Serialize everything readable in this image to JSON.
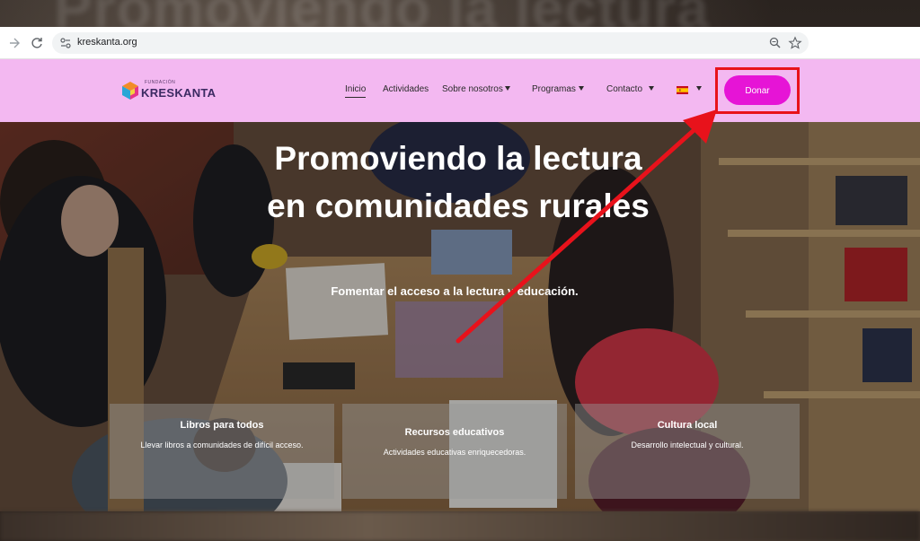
{
  "backdrop": {
    "blurred_title": "Promoviendo la lectura"
  },
  "browser": {
    "url": "kreskanta.org",
    "icons": {
      "back": "back-arrow-icon",
      "reload": "reload-icon",
      "site_info": "site-settings-icon",
      "zoom": "zoom-icon",
      "bookmark": "star-icon"
    }
  },
  "header": {
    "logo_small": "FUNDACIÓN",
    "logo_name": "KRESKANTA",
    "menu": {
      "inicio": "Inicio",
      "actividades": "Actividades",
      "sobre": "Sobre nosotros",
      "programas": "Programas",
      "contacto": "Contacto"
    },
    "language_flag": "spain-flag-icon",
    "donate_label": "Donar",
    "colors": {
      "header_bg": "#f3b8f1",
      "donate_bg": "#e614d6",
      "annotation": "#e8121b"
    }
  },
  "hero": {
    "title_line1": "Promoviendo la lectura",
    "title_line2": "en comunidades rurales",
    "subtitle": "Fomentar el acceso a la lectura y educación."
  },
  "features": [
    {
      "title": "Libros para todos",
      "desc": "Llevar libros a comunidades de difícil acceso."
    },
    {
      "title": "Recursos educativos",
      "desc": "Actividades educativas enriquecedoras."
    },
    {
      "title": "Cultura local",
      "desc": "Desarrollo intelectual y cultural."
    }
  ]
}
